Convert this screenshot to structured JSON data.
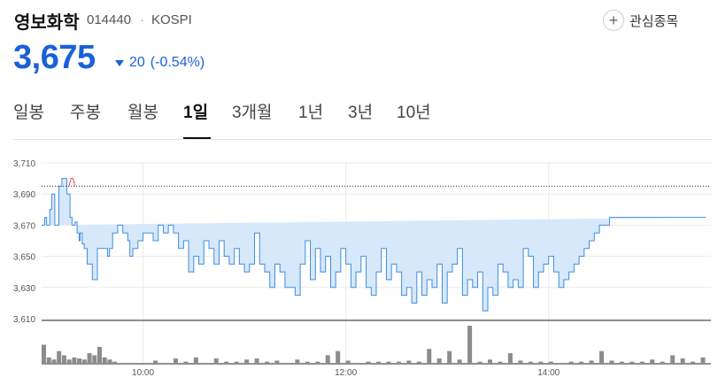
{
  "stock": {
    "name": "영보화학",
    "code": "014440",
    "separator": "·",
    "market": "KOSPI",
    "price": "3,675",
    "change": "20",
    "change_pct": "(-0.54%)",
    "direction": "down"
  },
  "favorite": {
    "label": "관심종목",
    "icon": "plus-icon"
  },
  "tabs": [
    {
      "label": "일봉",
      "active": false
    },
    {
      "label": "주봉",
      "active": false
    },
    {
      "label": "월봉",
      "active": false
    },
    {
      "label": "1일",
      "active": true
    },
    {
      "label": "3개월",
      "active": false
    },
    {
      "label": "1년",
      "active": false
    },
    {
      "label": "3년",
      "active": false
    },
    {
      "label": "10년",
      "active": false
    }
  ],
  "colors": {
    "accent": "#1a61d9",
    "line": "#3d8fe0",
    "fill": "#d7e8fb",
    "up": "#e84848",
    "volume": "#8c8c8c"
  },
  "chart_data": {
    "type": "area",
    "ylim": [
      3610,
      3710
    ],
    "y_ticks": [
      "3,710",
      "3,690",
      "3,670",
      "3,650",
      "3,630",
      "3,610"
    ],
    "x_ticks": [
      "10:00",
      "12:00",
      "14:00"
    ],
    "prev_close": 3695,
    "price_series": {
      "x": [
        9.0,
        9.03,
        9.05,
        9.08,
        9.1,
        9.13,
        9.17,
        9.2,
        9.25,
        9.28,
        9.3,
        9.33,
        9.35,
        9.37,
        9.38,
        9.4,
        9.42,
        9.45,
        9.5,
        9.55,
        9.6,
        9.65,
        9.67,
        9.7,
        9.75,
        9.8,
        9.85,
        9.87,
        9.9,
        9.92,
        9.95,
        10.0,
        10.05,
        10.1,
        10.15,
        10.2,
        10.25,
        10.3,
        10.35,
        10.4,
        10.45,
        10.5,
        10.55,
        10.6,
        10.65,
        10.7,
        10.75,
        10.8,
        10.85,
        10.9,
        10.95,
        11.0,
        11.05,
        11.1,
        11.15,
        11.2,
        11.25,
        11.3,
        11.35,
        11.4,
        11.45,
        11.5,
        11.55,
        11.6,
        11.65,
        11.7,
        11.75,
        11.8,
        11.85,
        11.9,
        11.95,
        12.0,
        12.05,
        12.1,
        12.15,
        12.2,
        12.25,
        12.3,
        12.35,
        12.4,
        12.45,
        12.5,
        12.55,
        12.6,
        12.65,
        12.7,
        12.75,
        12.8,
        12.85,
        12.9,
        12.95,
        13.0,
        13.05,
        13.1,
        13.15,
        13.2,
        13.25,
        13.3,
        13.35,
        13.4,
        13.45,
        13.5,
        13.55,
        13.6,
        13.65,
        13.7,
        13.75,
        13.8,
        13.85,
        13.9,
        13.95,
        14.0,
        14.05,
        14.1,
        14.15,
        14.2,
        14.25,
        14.3,
        14.35,
        14.4,
        14.45,
        14.5,
        14.55,
        14.6,
        14.65,
        14.7,
        14.75,
        14.8,
        14.85,
        14.9,
        14.95,
        15.0,
        15.05,
        15.1,
        15.15,
        15.2,
        15.25,
        15.3,
        15.35,
        15.4,
        15.45,
        15.5,
        15.55,
        15.6
      ],
      "y": [
        3670,
        3675,
        3670,
        3680,
        3690,
        3670,
        3695,
        3700,
        3690,
        3675,
        3670,
        3672,
        3665,
        3660,
        3665,
        3658,
        3655,
        3645,
        3635,
        3655,
        3655,
        3650,
        3655,
        3665,
        3670,
        3665,
        3660,
        3650,
        3655,
        3655,
        3660,
        3665,
        3665,
        3660,
        3670,
        3665,
        3670,
        3665,
        3655,
        3660,
        3640,
        3650,
        3645,
        3660,
        3655,
        3645,
        3660,
        3650,
        3645,
        3655,
        3645,
        3640,
        3645,
        3665,
        3645,
        3640,
        3630,
        3645,
        3640,
        3630,
        3630,
        3625,
        3645,
        3660,
        3635,
        3655,
        3640,
        3650,
        3630,
        3640,
        3655,
        3645,
        3630,
        3640,
        3650,
        3630,
        3625,
        3640,
        3655,
        3635,
        3645,
        3640,
        3625,
        3630,
        3620,
        3640,
        3625,
        3635,
        3630,
        3645,
        3620,
        3640,
        3645,
        3655,
        3625,
        3635,
        3630,
        3640,
        3615,
        3630,
        3625,
        3645,
        3640,
        3630,
        3635,
        3630,
        3655,
        3650,
        3630,
        3640,
        3645,
        3650,
        3640,
        3630,
        3635,
        3640,
        3645,
        3650,
        3655,
        3660,
        3665,
        3670,
        3670,
        3675,
        3675,
        3675,
        3675,
        3675,
        3675,
        3675,
        3675,
        3675,
        3675,
        3675,
        3675,
        3675,
        3675,
        3675,
        3675,
        3675,
        3675,
        3675
      ],
      "up_segment": {
        "x": [
          9.27,
          9.29,
          9.31,
          9.33
        ],
        "y": [
          3695,
          3700,
          3700,
          3695
        ]
      }
    },
    "volume_series": {
      "x": [
        9.0,
        9.05,
        9.1,
        9.15,
        9.2,
        9.25,
        9.3,
        9.35,
        9.4,
        9.45,
        9.5,
        9.55,
        9.6,
        9.65,
        9.7,
        10.1,
        10.3,
        10.4,
        10.5,
        10.7,
        10.8,
        10.9,
        11.0,
        11.1,
        11.2,
        11.3,
        11.5,
        11.6,
        11.7,
        11.8,
        11.9,
        12.0,
        12.2,
        12.3,
        12.4,
        12.5,
        12.6,
        12.7,
        12.8,
        12.9,
        13.0,
        13.1,
        13.2,
        13.3,
        13.4,
        13.5,
        13.6,
        13.7,
        13.8,
        13.9,
        14.0,
        14.2,
        14.3,
        14.4,
        14.5,
        14.6,
        14.7,
        14.8,
        14.9,
        15.0,
        15.1,
        15.2,
        15.3,
        15.4,
        15.5
      ],
      "values": [
        18,
        6,
        4,
        12,
        8,
        4,
        6,
        5,
        4,
        10,
        8,
        16,
        6,
        4,
        2,
        3,
        5,
        2,
        6,
        5,
        2,
        2,
        4,
        5,
        2,
        3,
        4,
        2,
        2,
        8,
        12,
        3,
        2,
        2,
        2,
        2,
        3,
        2,
        14,
        5,
        12,
        4,
        36,
        2,
        4,
        2,
        10,
        3,
        2,
        2,
        2,
        2,
        2,
        3,
        12,
        3,
        2,
        2,
        2,
        4,
        2,
        8,
        5,
        2,
        6
      ]
    }
  }
}
